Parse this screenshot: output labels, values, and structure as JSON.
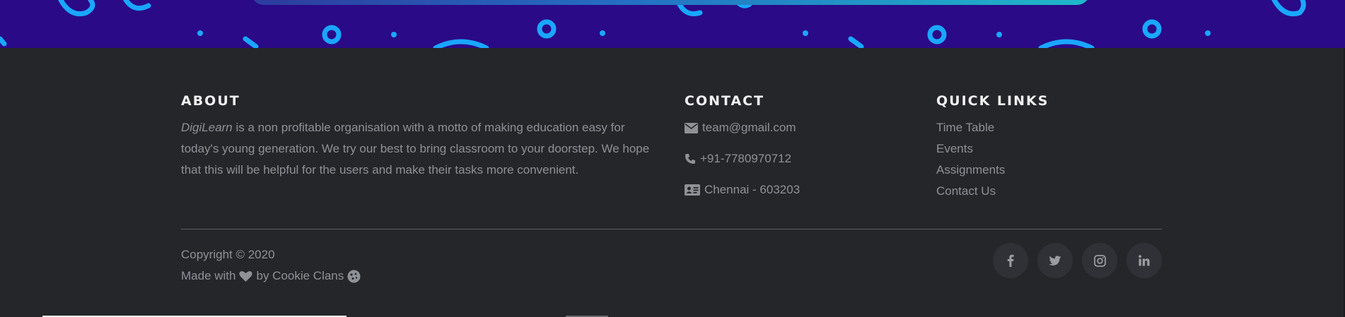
{
  "colors": {
    "banner_bg": "#2a0a86",
    "banner_pattern": "#1aa7ff",
    "footer_bg": "#25262a",
    "heading": "#f1f1f1",
    "text": "#8e9196",
    "social_bg": "#303136"
  },
  "about": {
    "title": "ABOUT",
    "brand": "DigiLearn",
    "text": " is a non profitable organisation with a motto of making education easy for today's young generation. We try our best to bring classroom to your doorstep. We hope that this will be helpful for the users and make their tasks more convenient."
  },
  "contact": {
    "title": "CONTACT",
    "items": [
      {
        "icon": "envelope-icon",
        "text": "team@gmail.com"
      },
      {
        "icon": "phone-icon",
        "text": "+91-7780970712"
      },
      {
        "icon": "address-card-icon",
        "text": "Chennai - 603203"
      }
    ]
  },
  "quick_links": {
    "title": "QUICK LINKS",
    "items": [
      "Time Table",
      "Events",
      "Assignments",
      "Contact Us"
    ]
  },
  "copyright": {
    "line1": "Copyright © 2020",
    "made_with": "Made with",
    "by": "by Cookie Clans"
  },
  "socials": [
    {
      "icon": "facebook-icon"
    },
    {
      "icon": "twitter-icon"
    },
    {
      "icon": "instagram-icon"
    },
    {
      "icon": "linkedin-icon"
    }
  ]
}
